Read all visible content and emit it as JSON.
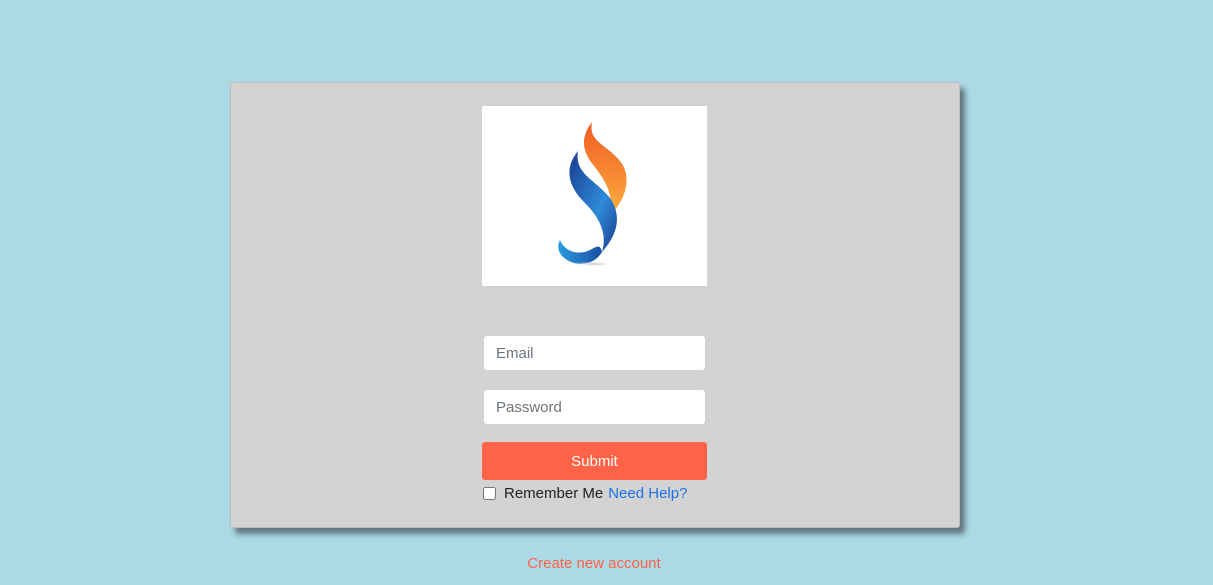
{
  "login_form": {
    "logo": "flame-logo-icon",
    "email_placeholder": "Email",
    "email_value": "",
    "password_placeholder": "Password",
    "password_value": "",
    "submit_label": "Submit",
    "remember_label": "Remember Me",
    "remember_checked": false,
    "help_link": "Need Help?"
  },
  "footer": {
    "create_account_link": "Create new account"
  },
  "colors": {
    "background": "#add8e6",
    "card": "#d3d3d3",
    "accent": "#ff6347",
    "link": "#1a73e8"
  }
}
